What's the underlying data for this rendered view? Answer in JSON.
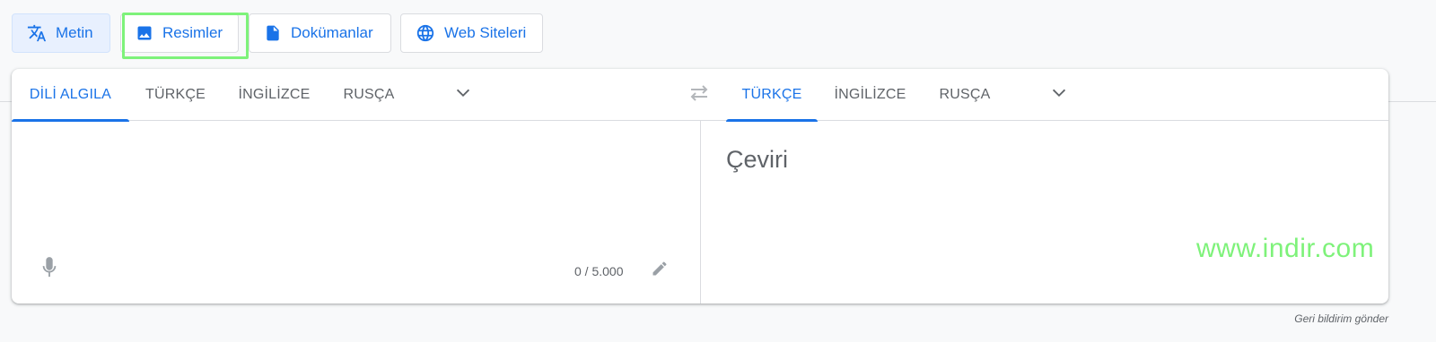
{
  "modes": [
    {
      "label": "Metin",
      "icon": "translate-icon",
      "active": true
    },
    {
      "label": "Resimler",
      "icon": "image-icon",
      "active": false
    },
    {
      "label": "Dokümanlar",
      "icon": "document-icon",
      "active": false
    },
    {
      "label": "Web Siteleri",
      "icon": "globe-icon",
      "active": false
    }
  ],
  "source_langs": [
    "DİLİ ALGILA",
    "TÜRKÇE",
    "İNGİLİZCE",
    "RUSÇA"
  ],
  "target_langs": [
    "TÜRKÇE",
    "İNGİLİZCE",
    "RUSÇA"
  ],
  "source": {
    "counter": "0 / 5.000"
  },
  "target": {
    "placeholder": "Çeviri"
  },
  "watermark": "www.indir.com",
  "footer": {
    "feedback": "Geri bildirim gönder"
  },
  "colors": {
    "accent": "#1a73e8",
    "highlight": "#7ef27a"
  }
}
